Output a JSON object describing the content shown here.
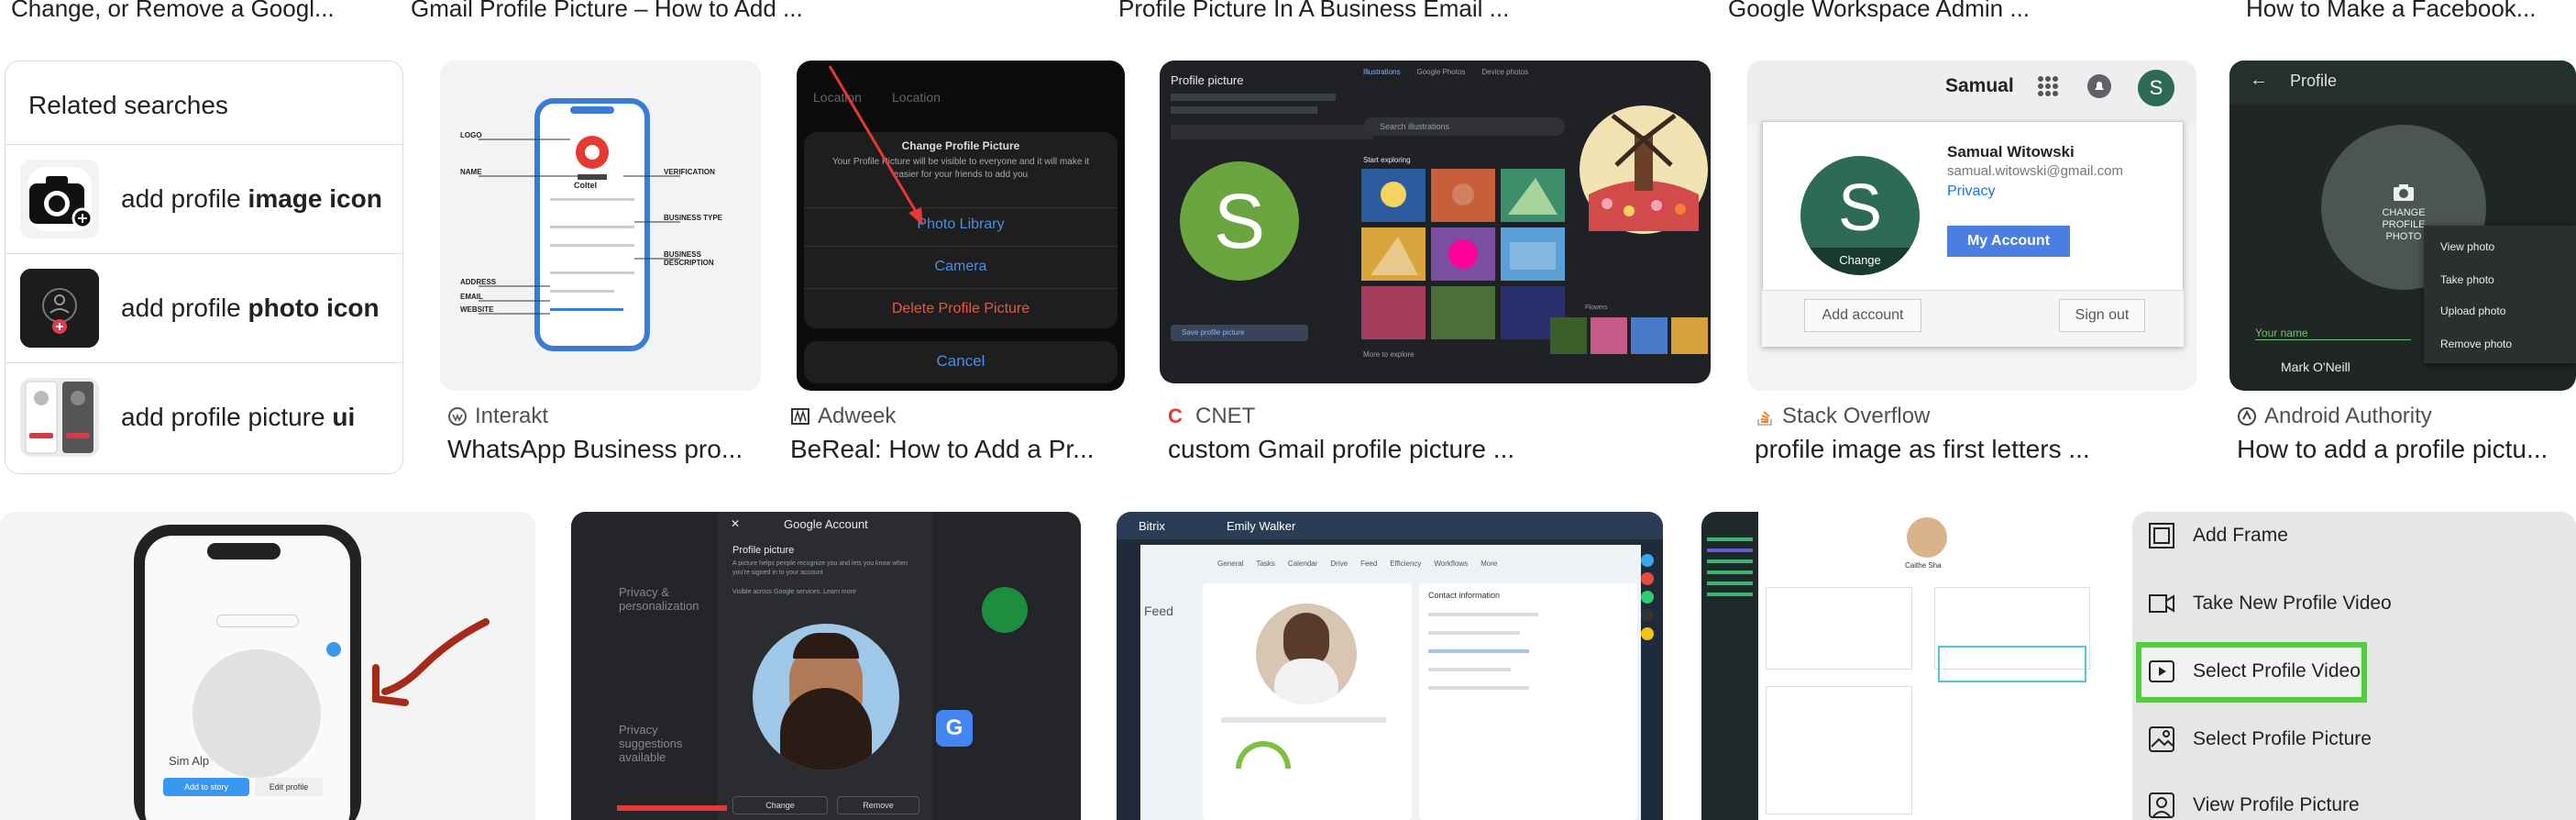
{
  "top_titles": [
    "Change, or Remove a Googl...",
    "Gmail Profile Picture – How to Add ...",
    "Profile Picture In A Business Email ...",
    "Google Workspace Admin ...",
    "How to Make a Facebook..."
  ],
  "related": {
    "title": "Related searches",
    "items": [
      {
        "prefix": "add profile ",
        "bold": "image icon"
      },
      {
        "prefix": "add profile ",
        "bold": "photo icon"
      },
      {
        "prefix": "add profile picture ",
        "bold": "ui"
      }
    ]
  },
  "results": [
    {
      "source": "Interakt",
      "caption": "WhatsApp Business pro..."
    },
    {
      "source": "Adweek",
      "caption": "BeReal: How to Add a Pr..."
    },
    {
      "source": "CNET",
      "caption": "custom Gmail profile picture ..."
    },
    {
      "source": "Stack Overflow",
      "caption": "profile image as first letters ..."
    },
    {
      "source": "Android Authority",
      "caption": "How to add a profile pictu..."
    }
  ],
  "tile_whatsapp": {
    "labels": [
      "LOGO",
      "NAME",
      "VERIFICATION",
      "BUSINESS TYPE",
      "BUSINESS DESCRIPTION",
      "ADDRESS",
      "EMAIL",
      "WEBSITE"
    ],
    "brand": "Coltel"
  },
  "tile_bereal": {
    "tabs": [
      "Location",
      "Location"
    ],
    "title": "Change Profile Picture",
    "desc": "Your Profile Picture will be visible to everyone and it will make it easier for your friends to add you",
    "options": [
      "Photo Library",
      "Camera",
      "Delete Profile Picture"
    ],
    "cancel": "Cancel"
  },
  "tile_cnet": {
    "heading": "Profile picture",
    "tabs": [
      "Illustrations",
      "Google Photos",
      "Device photos"
    ],
    "search": "Search illustrations",
    "section": "Start exploring",
    "initial": "S",
    "save": "Save profile picture",
    "footer": "More to explore",
    "sub": "Flowers"
  },
  "tile_stack": {
    "top_name": "Samual",
    "top_initial": "S",
    "initial": "S",
    "change": "Change",
    "name": "Samual Witowski",
    "email": "samual.witowski@gmail.com",
    "privacy": "Privacy",
    "account_btn": "My Account",
    "add_account": "Add account",
    "sign_out": "Sign out"
  },
  "tile_android": {
    "header": "Profile",
    "change": "CHANGE PROFILE PHOTO",
    "menu": [
      "View photo",
      "Take photo",
      "Upload photo",
      "Remove photo"
    ],
    "your_name": "Your name",
    "name": "Mark O'Neill"
  },
  "tile_phone": {
    "add_story": "Add to story",
    "edit": "Edit profile",
    "name": "Sim Alp"
  },
  "tile_google": {
    "title": "Google Account",
    "subtitle": "Profile picture",
    "desc": "A picture helps people recognize you and lets you know when you're signed in to your account",
    "visible": "Visible across Google services. Learn more",
    "side1": "Privacy & personalization",
    "side2": "Privacy suggestions available",
    "change": "Change",
    "remove": "Remove"
  },
  "tile_bitrix": {
    "app": "Bitrix",
    "user": "Emily Walker",
    "tabs": [
      "General",
      "Tasks",
      "Calendar",
      "Drive",
      "Feed",
      "Efficiency",
      "Workflows",
      "More"
    ],
    "feed": "Feed",
    "contact": "Contact information"
  },
  "tile_profile_form": {
    "name": "Caithe Sha"
  },
  "tile_menu": {
    "items": [
      "Add Frame",
      "Take New Profile Video",
      "Select Profile Video",
      "Select Profile Picture",
      "View Profile Picture"
    ],
    "highlight_color": "#4cd137"
  }
}
